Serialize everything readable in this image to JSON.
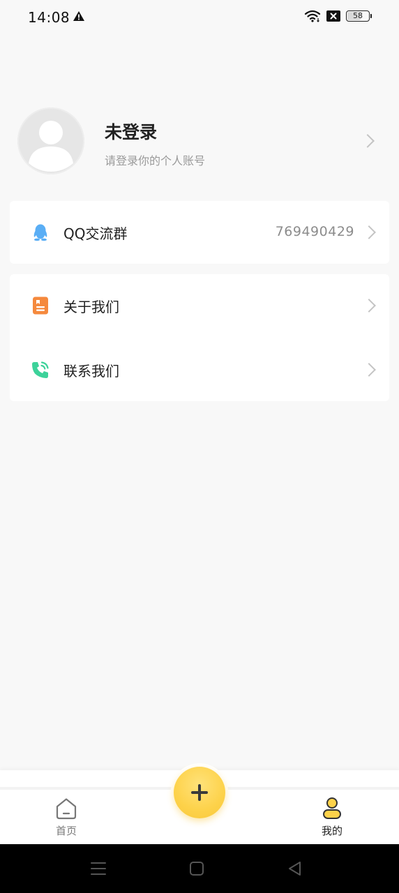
{
  "status_bar": {
    "time": "14:08",
    "battery": "58"
  },
  "profile": {
    "name": "未登录",
    "subtitle": "请登录你的个人账号"
  },
  "qq_group": {
    "label": "QQ交流群",
    "value": "769490429"
  },
  "info_rows": [
    {
      "label": "关于我们",
      "icon": "document-icon"
    },
    {
      "label": "联系我们",
      "icon": "phone-icon"
    }
  ],
  "tabbar": {
    "home_label": "首页",
    "mine_label": "我的",
    "fab_icon": "plus-icon"
  },
  "colors": {
    "accent": "#fdd24a",
    "qq_icon": "#5aaef5",
    "document_icon": "#f5893d",
    "phone_icon": "#3dd29a",
    "background": "#f8f8f8"
  }
}
